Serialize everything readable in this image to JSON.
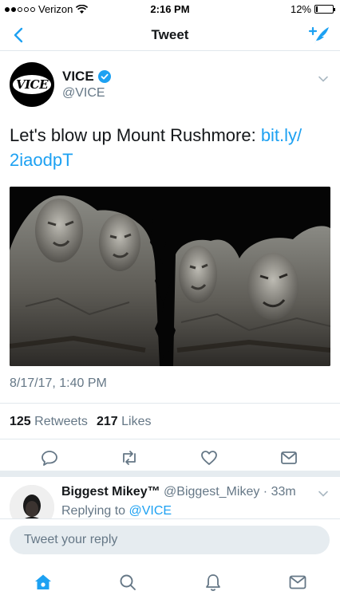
{
  "status_bar": {
    "carrier": "Verizon",
    "time": "2:16 PM",
    "battery_percent": "12%",
    "battery_level": 0.12,
    "signal_bars_filled": 2,
    "signal_bars_total": 5
  },
  "nav": {
    "title": "Tweet",
    "back_icon": "chevron-left-icon",
    "compose_icon": "compose-feather-icon"
  },
  "tweet": {
    "author": {
      "name": "VICE",
      "handle": "@VICE",
      "avatar_text": "VICE",
      "verified": true
    },
    "text": "Let's blow up Mount Rushmore: ",
    "link": "bit.ly/\n2iaodpT",
    "timestamp": "8/17/17, 1:40 PM",
    "retweets": {
      "count": "125",
      "label": "Retweets"
    },
    "likes": {
      "count": "217",
      "label": "Likes"
    },
    "actions": [
      "reply-icon",
      "retweet-icon",
      "like-icon",
      "share-icon"
    ]
  },
  "reply": {
    "name": "Biggest Mikey™",
    "handle": "@Biggest_Mikey",
    "time": "33m",
    "replying_label": "Replying to",
    "replying_to": "@VICE"
  },
  "composer": {
    "placeholder": "Tweet your reply"
  },
  "tabs": [
    "home-icon",
    "search-icon",
    "notifications-icon",
    "messages-icon"
  ],
  "colors": {
    "accent": "#1da1f2",
    "secondary_text": "#657786",
    "primary_text": "#14171a"
  }
}
